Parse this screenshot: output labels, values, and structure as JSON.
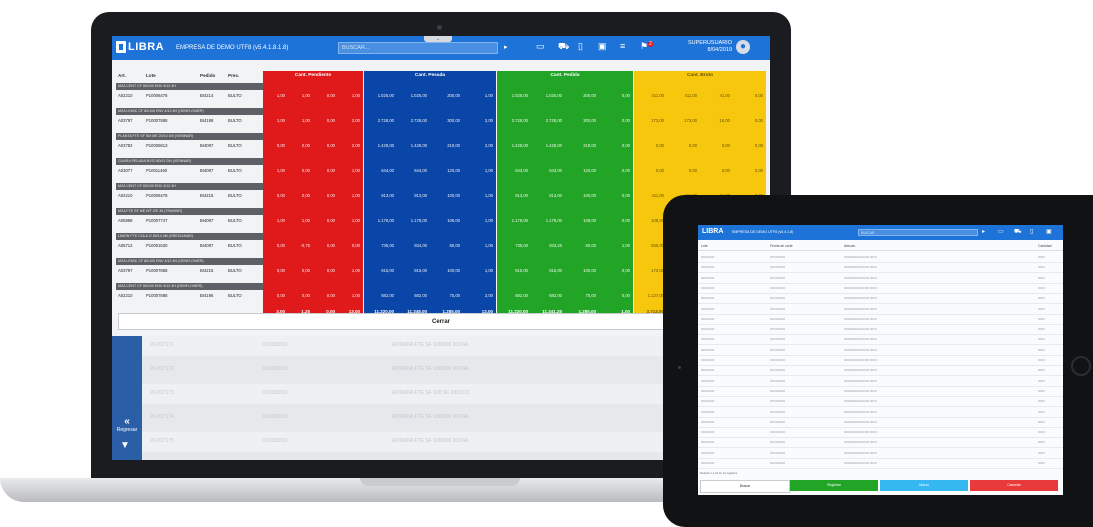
{
  "app": {
    "logo": "LIBRA",
    "company": "EMPRESA DE DEMO UTF8  (v5.4.1.8.1.8)",
    "search_placeholder": "BUSCAR...",
    "search_tab": "⌄",
    "go": "▸",
    "user_name": "SUPERUSUARIO",
    "user_date": "8/04/2019",
    "notification_count": "2"
  },
  "colors": {
    "topbar": "#1e73d8",
    "pendiente": "#e0191b",
    "pesada": "#0a45a8",
    "pedida": "#22a526",
    "bruto": "#f6c70d"
  },
  "table": {
    "headers": {
      "art": "Art.",
      "lote": "Lote",
      "pedido": "Pedido",
      "pres": "Pres."
    },
    "groups": [
      {
        "title": "Cant. Pendiente",
        "color": "#e0191b"
      },
      {
        "title": "Cant. Pesada",
        "color": "#0a45a8"
      },
      {
        "title": "Cant. Pedida",
        "color": "#22a526"
      },
      {
        "title": "Cant. Bruto",
        "color": "#f6c70d"
      }
    ],
    "rows": [
      {
        "desc": "MZA CENT CF 80/100 ENV 4/12 4H",
        "art": "A02210",
        "lote": "P10006478",
        "pedido": "BI4214",
        "pres": "BULTO",
        "r": [
          "1,00",
          "1,00",
          "0,00",
          "1,00"
        ],
        "b": [
          "1.025,00",
          "1.025,00",
          "200,00",
          "1,00"
        ],
        "g": [
          "1.025,00",
          "1.025,00",
          "200,00",
          "0,00"
        ],
        "y": [
          "411,00",
          "411,00",
          "41,00",
          "0,00"
        ]
      },
      {
        "desc": "MZA LEMIC CF 80/100 ENV 4/12 4H (GENFLOWER)",
        "art": "A03797",
        "lote": "P10007888",
        "pedido": "BI4198",
        "pres": "BULTO",
        "r": [
          "1,00",
          "1,00",
          "0,00",
          "2,00"
        ],
        "b": [
          "2.728,00",
          "2.728,00",
          "300,00",
          "2,00"
        ],
        "g": [
          "2.728,00",
          "2.728,00",
          "300,00",
          "0,00"
        ],
        "y": [
          "173,00",
          "173,00",
          "15,00",
          "0,00"
        ]
      },
      {
        "desc": "PLANTA FTE SF SM ME 20/10 DN (VIENNAR)",
        "art": "A03782",
        "lote": "P10005813",
        "pedido": "BI4097",
        "pres": "BULTO",
        "r": [
          "0,00",
          "0,00",
          "0,00",
          "2,00"
        ],
        "b": [
          "1.428,00",
          "1.428,00",
          "219,00",
          "2,00"
        ],
        "g": [
          "1.428,00",
          "1.428,00",
          "219,00",
          "0,00"
        ],
        "y": [
          "0,00",
          "0,00",
          "0,00",
          "0,00"
        ]
      },
      {
        "desc": "GUARA PELADA 50/70 80/12 DN (VIENNAR)",
        "art": "A03077",
        "lote": "P10011460",
        "pedido": "BI4097",
        "pres": "BULTO",
        "r": [
          "1,00",
          "0,00",
          "0,00",
          "1,00"
        ],
        "b": [
          "644,00",
          "644,00",
          "120,00",
          "1,00"
        ],
        "g": [
          "643,00",
          "643,00",
          "120,00",
          "0,00"
        ],
        "y": [
          "0,00",
          "0,00",
          "0,00",
          "0,00"
        ]
      },
      {
        "desc": "MZA CENT CF 80/100 ENV 4/12 4H",
        "art": "A02210",
        "lote": "P10006478",
        "pedido": "BI4215",
        "pres": "BULTO",
        "r": [
          "0,00",
          "0,00",
          "0,00",
          "1,00"
        ],
        "b": [
          "913,00",
          "913,00",
          "100,00",
          "1,00"
        ],
        "g": [
          "913,00",
          "913,00",
          "100,00",
          "0,00"
        ],
        "y": [
          "411,00",
          "411,00",
          "41,00",
          "0,00"
        ]
      },
      {
        "desc": "MZA FTE SF ME WT 2/E 36 (TRANSIR)",
        "art": "A05998",
        "lote": "P10007747",
        "pedido": "BI4097",
        "pres": "BULTO",
        "r": [
          "1,00",
          "1,00",
          "0,00",
          "1,00"
        ],
        "b": [
          "1.178,00",
          "1.178,00",
          "108,00",
          "1,00"
        ],
        "g": [
          "1.178,00",
          "1.178,00",
          "108,00",
          "0,00"
        ],
        "y": [
          "108,00",
          "",
          "",
          ""
        ]
      },
      {
        "desc": "LIMON FTE COLA 2/ 50/14 4M (GRECIAMAR)",
        "art": "A05712",
        "lote": "P10001530",
        "pedido": "BI4097",
        "pres": "BULTO",
        "r": [
          "0,00",
          "-0,75",
          "0,00",
          "0,00"
        ],
        "b": [
          "735,00",
          "934,00",
          "80,00",
          "1,00"
        ],
        "g": [
          "735,00",
          "933,25",
          "80,00",
          "1,00"
        ],
        "y": [
          "835,00",
          "",
          "",
          ""
        ]
      },
      {
        "desc": "MZA LEMIC CF 80/100 ENV 4/12 4H (GENFLOWER)",
        "art": "A03797",
        "lote": "P10007888",
        "pedido": "BI4215",
        "pres": "BULTO",
        "r": [
          "0,00",
          "0,00",
          "0,00",
          "1,00"
        ],
        "b": [
          "915,00",
          "915,00",
          "100,00",
          "1,00"
        ],
        "g": [
          "915,00",
          "915,00",
          "100,00",
          "0,00"
        ],
        "y": [
          "173,00",
          "",
          "",
          ""
        ]
      },
      {
        "desc": "MZA CENT CF 80/100 ENV 4/12 4H (GENFLOWER)",
        "art": "A02210",
        "lote": "P10007888",
        "pedido": "BI4195",
        "pres": "BULTO",
        "r": [
          "0,00",
          "0,00",
          "0,00",
          "1,00"
        ],
        "b": [
          "682,00",
          "682,00",
          "75,00",
          "2,00"
        ],
        "g": [
          "682,00",
          "682,00",
          "75,00",
          "0,00"
        ],
        "y": [
          "1.137,00",
          "",
          "",
          ""
        ]
      }
    ],
    "totals": {
      "r": [
        "3,00",
        "1,25",
        "0,00",
        "13,00"
      ],
      "b": [
        "11.220,00",
        "11.348,00",
        "1.285,00",
        "13,00"
      ],
      "g": [
        "11.220,00",
        "11.341,25",
        "1.285,00",
        "1,00"
      ],
      "y": [
        "3.713,00"
      ]
    }
  },
  "close_label": "Cerrar",
  "lower_list": {
    "back_label": "Regresar",
    "rows": [
      {
        "a": "20-017171",
        "b": "01/03/2019",
        "c": "RODADA FTE SF 100/000 20/14A"
      },
      {
        "a": "20-017172",
        "b": "01/03/2019",
        "c": "RODADA FTE SF 100/000 20/14A"
      },
      {
        "a": "20-017173",
        "b": "01/03/2019",
        "c": "RODADA FTE SF 100 SF 20/11/21"
      },
      {
        "a": "20-017174",
        "b": "01/03/2019",
        "c": "RODADA FTE SF 100/000 20/14A"
      },
      {
        "a": "20-017175",
        "b": "01/03/2019",
        "c": "RODADA FTE SF 100/000 20/14A"
      }
    ]
  },
  "tablet": {
    "logo": "LIBRA",
    "company": "EMPRESA DE DEMO UTF8  (v5.4.1.8)",
    "search_placeholder": "BUSCAR...",
    "headers": {
      "c1": "Lote",
      "c2": "Fecha de corte",
      "c3": "Articulo",
      "c4": "Cantidad"
    },
    "rows": [
      {
        "c1": "00000000",
        "c2": "00/00/0000",
        "c3": "000000000000000 0000",
        "c4": "0000"
      },
      {
        "c1": "00000000",
        "c2": "00/00/0000",
        "c3": "000000000000000 0000",
        "c4": "0000"
      },
      {
        "c1": "00000000",
        "c2": "00/00/0000",
        "c3": "000000000000000 0000",
        "c4": "0000"
      },
      {
        "c1": "00000000",
        "c2": "00/00/0000",
        "c3": "000000000000000 0000",
        "c4": "0000"
      },
      {
        "c1": "00000000",
        "c2": "00/00/0000",
        "c3": "000000000000000 0000",
        "c4": "0000"
      },
      {
        "c1": "00000000",
        "c2": "00/00/0000",
        "c3": "000000000000000 0000",
        "c4": "0000"
      },
      {
        "c1": "00000000",
        "c2": "00/00/0000",
        "c3": "000000000000000 0000",
        "c4": "0000"
      },
      {
        "c1": "00000000",
        "c2": "00/00/0000",
        "c3": "000000000000000 0000",
        "c4": "0000"
      },
      {
        "c1": "00000000",
        "c2": "00/00/0000",
        "c3": "000000000000000 0000",
        "c4": "0000"
      },
      {
        "c1": "00000000",
        "c2": "00/00/0000",
        "c3": "000000000000000 0000",
        "c4": "0000"
      },
      {
        "c1": "00000000",
        "c2": "00/00/0000",
        "c3": "000000000000000 0000",
        "c4": "0000"
      },
      {
        "c1": "00000000",
        "c2": "00/00/0000",
        "c3": "000000000000000 0000",
        "c4": "0000"
      },
      {
        "c1": "00000000",
        "c2": "00/00/0000",
        "c3": "000000000000000 0000",
        "c4": "0000"
      },
      {
        "c1": "00000000",
        "c2": "00/00/0000",
        "c3": "000000000000000 0000",
        "c4": "0000"
      },
      {
        "c1": "00000000",
        "c2": "00/00/0000",
        "c3": "000000000000000 0000",
        "c4": "0000"
      },
      {
        "c1": "00000000",
        "c2": "00/00/0000",
        "c3": "000000000000000 0000",
        "c4": "0000"
      },
      {
        "c1": "00000000",
        "c2": "00/00/0000",
        "c3": "000000000000000 0000",
        "c4": "0000"
      },
      {
        "c1": "00000000",
        "c2": "00/00/0000",
        "c3": "000000000000000 0000",
        "c4": "0000"
      },
      {
        "c1": "00000000",
        "c2": "00/00/0000",
        "c3": "000000000000000 0000",
        "c4": "0000"
      },
      {
        "c1": "00000000",
        "c2": "00/00/0000",
        "c3": "000000000000000 0000",
        "c4": "0000"
      },
      {
        "c1": "00000000",
        "c2": "00/00/0000",
        "c3": "000000000000000 0000",
        "c4": "0000"
      }
    ],
    "footer_text": "Mostrar 1 a 21 de 21 registros",
    "buttons": [
      {
        "label": "Buscar",
        "color": "#ffffff",
        "text": "#333333"
      },
      {
        "label": "Registrar",
        "color": "#22a526",
        "text": "#ffffff"
      },
      {
        "label": "Nuevo",
        "color": "#35b8f0",
        "text": "#ffffff"
      },
      {
        "label": "Cancelar",
        "color": "#e83a3a",
        "text": "#ffffff"
      }
    ]
  }
}
